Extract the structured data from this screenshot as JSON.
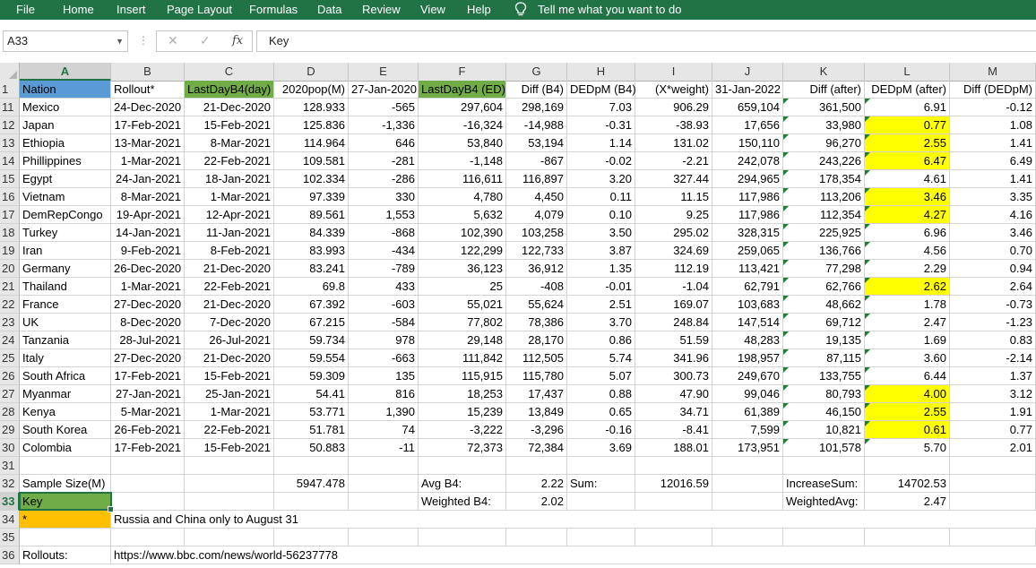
{
  "ribbon": {
    "menus": [
      "File",
      "Home",
      "Insert",
      "Page Layout",
      "Formulas",
      "Data",
      "Review",
      "View",
      "Help"
    ],
    "tell_me": "Tell me what you want to do"
  },
  "formula_bar": {
    "name_box": "A33",
    "formula": "Key"
  },
  "columns": [
    "A",
    "B",
    "C",
    "D",
    "E",
    "F",
    "G",
    "H",
    "I",
    "J",
    "K",
    "L",
    "M"
  ],
  "selected_column": "A",
  "selected_row": "33",
  "colors": {
    "header_green": "#70ad47",
    "blue": "#5b9bd5",
    "yellow": "#ffff00",
    "orange": "#ffc000",
    "excel_green": "#217346"
  },
  "header_row": {
    "row": "1",
    "cells": [
      "Nation",
      "Rollout*",
      "LastDayB4(day)",
      "2020pop(M)",
      "27-Jan-2020",
      "LastDayB4 (ED)",
      "Diff (B4)",
      "DEDpM (B4)",
      "(X*weight)",
      "31-Jan-2022",
      "Diff (after)",
      "DEDpM (after)",
      "Diff (DEDpM)"
    ]
  },
  "rows": [
    {
      "row": "11",
      "cells": [
        "Mexico",
        "24-Dec-2020",
        "21-Dec-2020",
        "128.933",
        "-565",
        "297,604",
        "298,169",
        "7.03",
        "906.29",
        "659,104",
        "361,500",
        "6.91",
        "-0.12"
      ],
      "yellow": false
    },
    {
      "row": "12",
      "cells": [
        "Japan",
        "17-Feb-2021",
        "15-Feb-2021",
        "125.836",
        "-1,336",
        "-16,324",
        "-14,988",
        "-0.31",
        "-38.93",
        "17,656",
        "33,980",
        "0.77",
        "1.08"
      ],
      "yellow": true
    },
    {
      "row": "13",
      "cells": [
        "Ethiopia",
        "13-Mar-2021",
        "8-Mar-2021",
        "114.964",
        "646",
        "53,840",
        "53,194",
        "1.14",
        "131.02",
        "150,110",
        "96,270",
        "2.55",
        "1.41"
      ],
      "yellow": true
    },
    {
      "row": "14",
      "cells": [
        "Phillippines",
        "1-Mar-2021",
        "22-Feb-2021",
        "109.581",
        "-281",
        "-1,148",
        "-867",
        "-0.02",
        "-2.21",
        "242,078",
        "243,226",
        "6.47",
        "6.49"
      ],
      "yellow": true
    },
    {
      "row": "15",
      "cells": [
        "Egypt",
        "24-Jan-2021",
        "18-Jan-2021",
        "102.334",
        "-286",
        "116,611",
        "116,897",
        "3.20",
        "327.44",
        "294,965",
        "178,354",
        "4.61",
        "1.41"
      ],
      "yellow": false
    },
    {
      "row": "16",
      "cells": [
        "Vietnam",
        "8-Mar-2021",
        "1-Mar-2021",
        "97.339",
        "330",
        "4,780",
        "4,450",
        "0.11",
        "11.15",
        "117,986",
        "113,206",
        "3.46",
        "3.35"
      ],
      "yellow": true
    },
    {
      "row": "17",
      "cells": [
        "DemRepCongo",
        "19-Apr-2021",
        "12-Apr-2021",
        "89.561",
        "1,553",
        "5,632",
        "4,079",
        "0.10",
        "9.25",
        "117,986",
        "112,354",
        "4.27",
        "4.16"
      ],
      "yellow": true
    },
    {
      "row": "18",
      "cells": [
        "Turkey",
        "14-Jan-2021",
        "11-Jan-2021",
        "84.339",
        "-868",
        "102,390",
        "103,258",
        "3.50",
        "295.02",
        "328,315",
        "225,925",
        "6.96",
        "3.46"
      ],
      "yellow": false
    },
    {
      "row": "19",
      "cells": [
        "Iran",
        "9-Feb-2021",
        "8-Feb-2021",
        "83.993",
        "-434",
        "122,299",
        "122,733",
        "3.87",
        "324.69",
        "259,065",
        "136,766",
        "4.56",
        "0.70"
      ],
      "yellow": false
    },
    {
      "row": "20",
      "cells": [
        "Germany",
        "26-Dec-2020",
        "21-Dec-2020",
        "83.241",
        "-789",
        "36,123",
        "36,912",
        "1.35",
        "112.19",
        "113,421",
        "77,298",
        "2.29",
        "0.94"
      ],
      "yellow": false
    },
    {
      "row": "21",
      "cells": [
        "Thailand",
        "1-Mar-2021",
        "22-Feb-2021",
        "69.8",
        "433",
        "25",
        "-408",
        "-0.01",
        "-1.04",
        "62,791",
        "62,766",
        "2.62",
        "2.64"
      ],
      "yellow": true
    },
    {
      "row": "22",
      "cells": [
        "France",
        "27-Dec-2020",
        "21-Dec-2020",
        "67.392",
        "-603",
        "55,021",
        "55,624",
        "2.51",
        "169.07",
        "103,683",
        "48,662",
        "1.78",
        "-0.73"
      ],
      "yellow": false
    },
    {
      "row": "23",
      "cells": [
        "UK",
        "8-Dec-2020",
        "7-Dec-2020",
        "67.215",
        "-584",
        "77,802",
        "78,386",
        "3.70",
        "248.84",
        "147,514",
        "69,712",
        "2.47",
        "-1.23"
      ],
      "yellow": false
    },
    {
      "row": "24",
      "cells": [
        "Tanzania",
        "28-Jul-2021",
        "26-Jul-2021",
        "59.734",
        "978",
        "29,148",
        "28,170",
        "0.86",
        "51.59",
        "48,283",
        "19,135",
        "1.69",
        "0.83"
      ],
      "yellow": false
    },
    {
      "row": "25",
      "cells": [
        "Italy",
        "27-Dec-2020",
        "21-Dec-2020",
        "59.554",
        "-663",
        "111,842",
        "112,505",
        "5.74",
        "341.96",
        "198,957",
        "87,115",
        "3.60",
        "-2.14"
      ],
      "yellow": false
    },
    {
      "row": "26",
      "cells": [
        "South Africa",
        "17-Feb-2021",
        "15-Feb-2021",
        "59.309",
        "135",
        "115,915",
        "115,780",
        "5.07",
        "300.73",
        "249,670",
        "133,755",
        "6.44",
        "1.37"
      ],
      "yellow": false
    },
    {
      "row": "27",
      "cells": [
        "Myanmar",
        "27-Jan-2021",
        "25-Jan-2021",
        "54.41",
        "816",
        "18,253",
        "17,437",
        "0.88",
        "47.90",
        "99,046",
        "80,793",
        "4.00",
        "3.12"
      ],
      "yellow": true
    },
    {
      "row": "28",
      "cells": [
        "Kenya",
        "5-Mar-2021",
        "1-Mar-2021",
        "53.771",
        "1,390",
        "15,239",
        "13,849",
        "0.65",
        "34.71",
        "61,389",
        "46,150",
        "2.55",
        "1.91"
      ],
      "yellow": true
    },
    {
      "row": "29",
      "cells": [
        "South Korea",
        "26-Feb-2021",
        "22-Feb-2021",
        "51.781",
        "74",
        "-3,222",
        "-3,296",
        "-0.16",
        "-8.41",
        "7,599",
        "10,821",
        "0.61",
        "0.77"
      ],
      "yellow": true
    },
    {
      "row": "30",
      "cells": [
        "Colombia",
        "17-Feb-2021",
        "15-Feb-2021",
        "50.883",
        "-11",
        "72,373",
        "72,384",
        "3.69",
        "188.01",
        "173,951",
        "101,578",
        "5.70",
        "2.01"
      ],
      "yellow": false
    }
  ],
  "summary": {
    "r31": "31",
    "r32": "32",
    "r33": "33",
    "r34": "34",
    "r35": "35",
    "r36": "36",
    "sample_size_label": "Sample Size(M)",
    "sample_size_value": "5947.478",
    "avg_b4_label": "Avg B4:",
    "avg_b4_value": "2.22",
    "sum_label": "Sum:",
    "sum_value": "12016.59",
    "increase_sum_label": "IncreaseSum:",
    "increase_sum_value": "14702.53",
    "weighted_b4_label": "Weighted B4:",
    "weighted_b4_value": "2.02",
    "weighted_avg_label": "WeightedAvg:",
    "weighted_avg_value": "2.47",
    "key_label": "Key",
    "star_label": "*",
    "star_note": "Russia and China only to August 31",
    "rollouts_label": "Rollouts:",
    "rollouts_url": "https://www.bbc.com/news/world-56237778"
  }
}
